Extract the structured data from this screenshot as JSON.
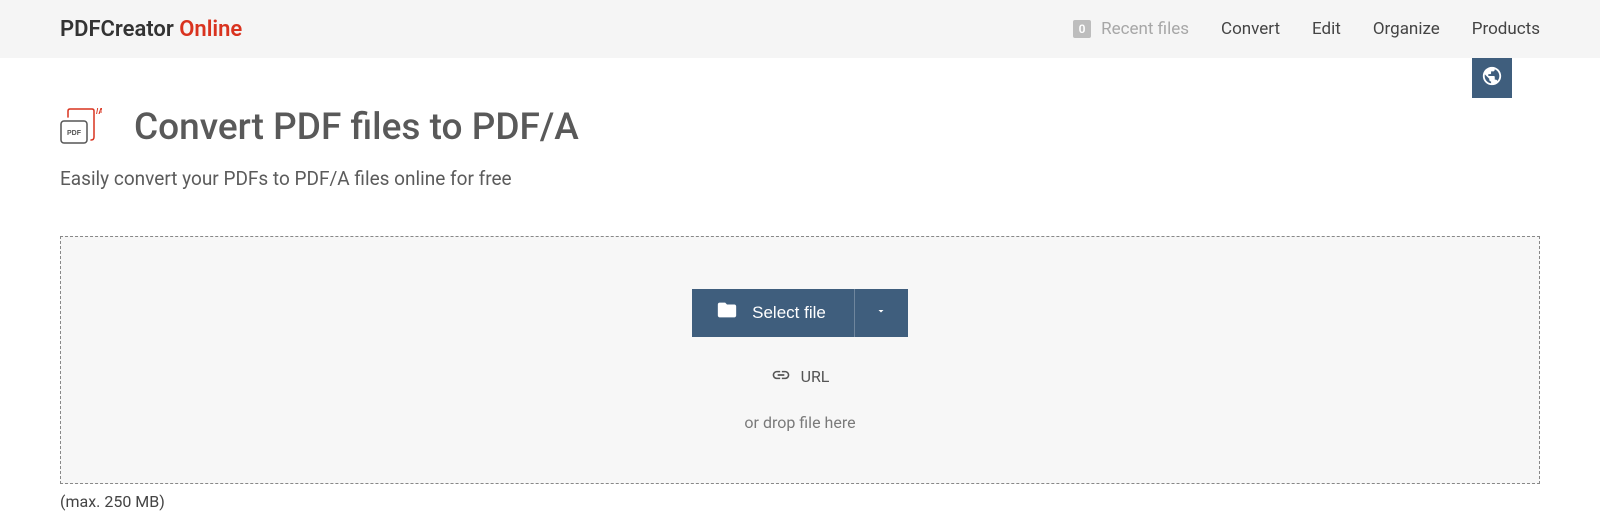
{
  "header": {
    "logo_main": "PDFCreator ",
    "logo_sub": "Online",
    "recent_badge": "0",
    "recent_label": "Recent files",
    "nav": {
      "convert": "Convert",
      "edit": "Edit",
      "organize": "Organize",
      "products": "Products"
    }
  },
  "page": {
    "title": "Convert PDF files to PDF/A",
    "subtitle": "Easily convert your PDFs to PDF/A files online for free",
    "icon_badge": "PDF",
    "icon_marker": "/A"
  },
  "dropzone": {
    "select_label": "Select file",
    "url_label": "URL",
    "drop_text": "or drop file here",
    "max_text": "(max. 250 MB)"
  }
}
